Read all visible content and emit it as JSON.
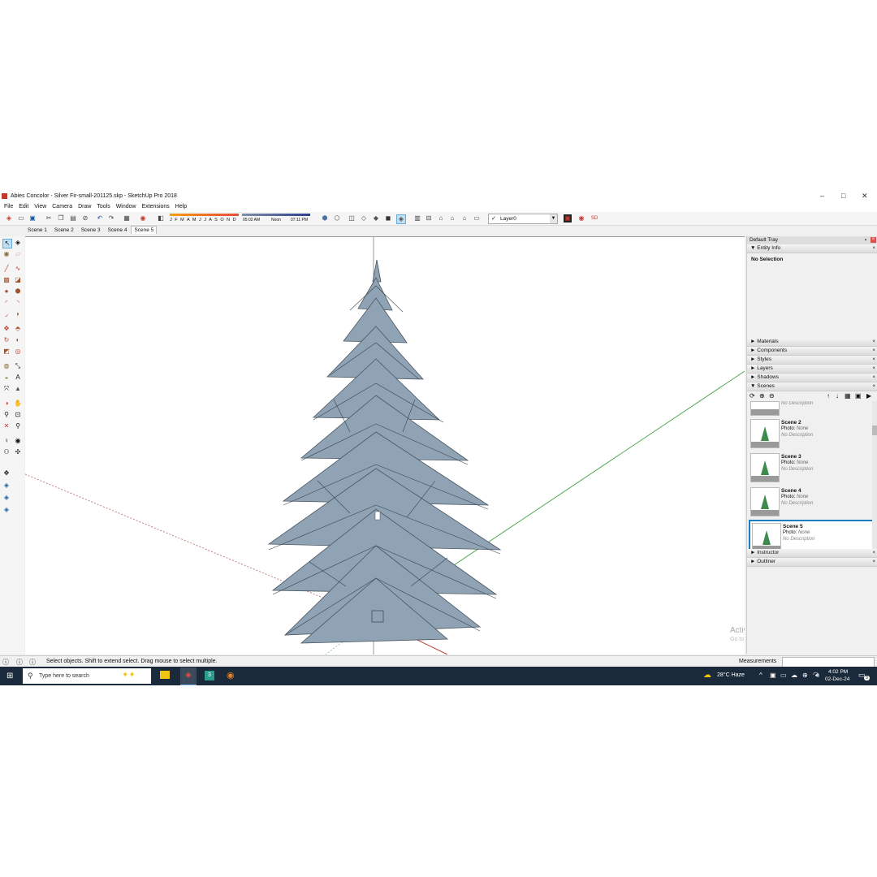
{
  "window": {
    "title": "Abies Concolor - Silver Fir-small-201125.skp - SketchUp Pro 2018",
    "minimize": "–",
    "maximize": "□",
    "close": "✕"
  },
  "menu": [
    "File",
    "Edit",
    "View",
    "Camera",
    "Draw",
    "Tools",
    "Window",
    "Extensions",
    "Help"
  ],
  "toolbar": {
    "months": "J F M A M J J A S O N D",
    "time_start": "05:02 AM",
    "time_mid": "Noon",
    "time_end": "07:11 PM",
    "layer": "Layer0"
  },
  "scene_tabs": [
    "Scene 1",
    "Scene 2",
    "Scene 3",
    "Scene 4",
    "Scene 5"
  ],
  "active_tab": "Scene 5",
  "tray": {
    "title": "Default Tray",
    "entity_info": "Entity Info",
    "selection": "No Selection",
    "panels": [
      "Materials",
      "Components",
      "Styles",
      "Layers",
      "Shadows"
    ],
    "scenes_label": "Scenes",
    "partial_scene_desc": "No Description",
    "scenes": [
      {
        "name": "Scene 2",
        "photo_label": "Photo:",
        "photo_value": "None",
        "desc": "No Description"
      },
      {
        "name": "Scene 3",
        "photo_label": "Photo:",
        "photo_value": "None",
        "desc": "No Description"
      },
      {
        "name": "Scene 4",
        "photo_label": "Photo:",
        "photo_value": "None",
        "desc": "No Description"
      },
      {
        "name": "Scene 5",
        "photo_label": "Photo:",
        "photo_value": "None",
        "desc": "No Description"
      }
    ],
    "bottom_panels": [
      "Instructor",
      "Outliner"
    ]
  },
  "watermark": {
    "line1": "Activate Windows",
    "line2": "Go to Settings to activate Windows."
  },
  "status": {
    "message": "Select objects. Shift to extend select. Drag mouse to select multiple.",
    "measurements": "Measurements"
  },
  "taskbar": {
    "search_placeholder": "Type here to search",
    "weather": "28°C  Haze",
    "time": "4:02 PM",
    "date": "02-Dec-24",
    "notif_count": "3"
  },
  "colors": {
    "selected_border": "#1a7fbf",
    "taskbar": "#1b2a3a",
    "tree": "#8fa3b5"
  }
}
